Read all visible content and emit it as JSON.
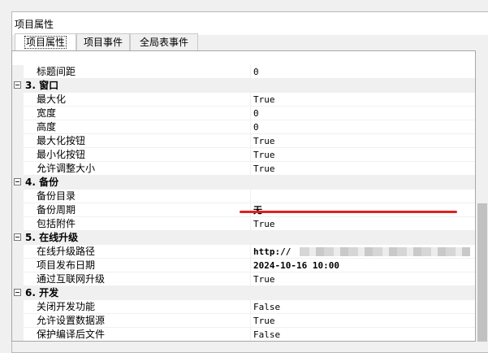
{
  "window": {
    "title": "项目属性",
    "close_glyph": "×"
  },
  "tabs": [
    {
      "label": "项目属性",
      "active": true
    },
    {
      "label": "项目事件",
      "active": false
    },
    {
      "label": "全局表事件",
      "active": false
    }
  ],
  "rows": [
    {
      "type": "prop",
      "name": "标题间距",
      "value": "0"
    },
    {
      "type": "cat",
      "name": "3. 窗口"
    },
    {
      "type": "prop",
      "name": "最大化",
      "value": "True"
    },
    {
      "type": "prop",
      "name": "宽度",
      "value": "0"
    },
    {
      "type": "prop",
      "name": "高度",
      "value": "0"
    },
    {
      "type": "prop",
      "name": "最大化按钮",
      "value": "True"
    },
    {
      "type": "prop",
      "name": "最小化按钮",
      "value": "True"
    },
    {
      "type": "prop",
      "name": "允许调整大小",
      "value": "True"
    },
    {
      "type": "cat",
      "name": "4. 备份"
    },
    {
      "type": "prop",
      "name": "备份目录",
      "value": ""
    },
    {
      "type": "prop",
      "name": "备份周期",
      "value": "无"
    },
    {
      "type": "prop",
      "name": "包括附件",
      "value": "True"
    },
    {
      "type": "cat",
      "name": "5. 在线升级"
    },
    {
      "type": "prop",
      "name": "在线升级路径",
      "value": "http://"
    },
    {
      "type": "prop",
      "name": "项目发布日期",
      "value": "2024-10-16 10:00"
    },
    {
      "type": "prop",
      "name": "通过互联网升级",
      "value": "True"
    },
    {
      "type": "cat",
      "name": "6. 开发"
    },
    {
      "type": "prop",
      "name": "关闭开发功能",
      "value": "False"
    },
    {
      "type": "prop",
      "name": "允许设置数据源",
      "value": "True"
    },
    {
      "type": "prop",
      "name": "保护编译后文件",
      "value": "False"
    }
  ],
  "colors": {
    "annotation_line": "#e02020",
    "category_background": "#f0f0f0"
  }
}
